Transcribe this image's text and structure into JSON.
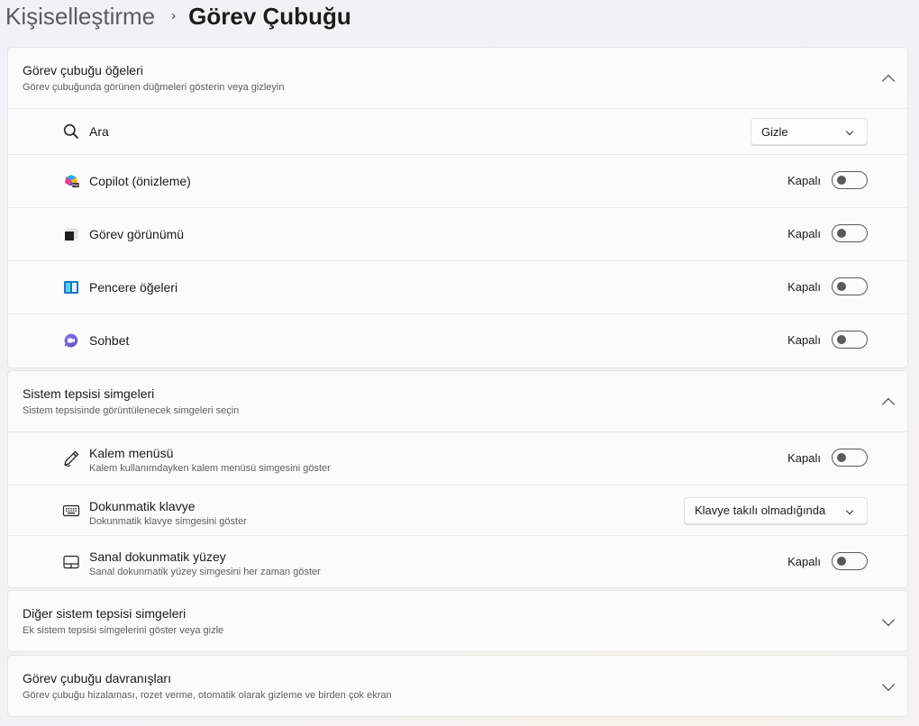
{
  "breadcrumb": {
    "parent": "Kişiselleştirme",
    "separator": "›",
    "current": "Görev Çubuğu"
  },
  "sections": [
    {
      "title": "Görev çubuğu öğeleri",
      "subtitle": "Görev çubuğunda görünen düğmeleri gösterin veya gizleyin",
      "expanded": true,
      "rows": [
        {
          "label": "Ara",
          "icon": "search-icon",
          "control": "dropdown",
          "value": "Gizle"
        },
        {
          "label": "Copilot (önizleme)",
          "icon": "copilot-icon",
          "control": "toggle",
          "state": "Kapalı"
        },
        {
          "label": "Görev görünümü",
          "icon": "task-view-icon",
          "control": "toggle",
          "state": "Kapalı"
        },
        {
          "label": "Pencere öğeleri",
          "icon": "widgets-icon",
          "control": "toggle",
          "state": "Kapalı"
        },
        {
          "label": "Sohbet",
          "icon": "chat-icon",
          "control": "toggle",
          "state": "Kapalı"
        }
      ]
    },
    {
      "title": "Sistem tepsisi simgeleri",
      "subtitle": "Sistem tepsisinde görüntülenecek simgeleri seçin",
      "expanded": true,
      "rows": [
        {
          "label": "Kalem menüsü",
          "description": "Kalem kullanımdayken kalem menüsü simgesini göster",
          "icon": "pen-icon",
          "control": "toggle",
          "state": "Kapalı"
        },
        {
          "label": "Dokunmatik klavye",
          "description": "Dokunmatik klavye simgesini göster",
          "icon": "keyboard-icon",
          "control": "dropdown",
          "value": "Klavye takılı olmadığında"
        },
        {
          "label": "Sanal dokunmatik yüzey",
          "description": "Sanal dokunmatik yüzey simgesini her zaman göster",
          "icon": "touchpad-icon",
          "control": "toggle",
          "state": "Kapalı"
        }
      ]
    },
    {
      "title": "Diğer sistem tepsisi simgeleri",
      "subtitle": "Ek sistem tepsisi simgelerini göster veya gizle",
      "expanded": false
    },
    {
      "title": "Görev çubuğu davranışları",
      "subtitle": "Görev çubuğu hizalaması, rozet verme, otomatik olarak gizleme ve birden çok ekran",
      "expanded": false
    }
  ]
}
